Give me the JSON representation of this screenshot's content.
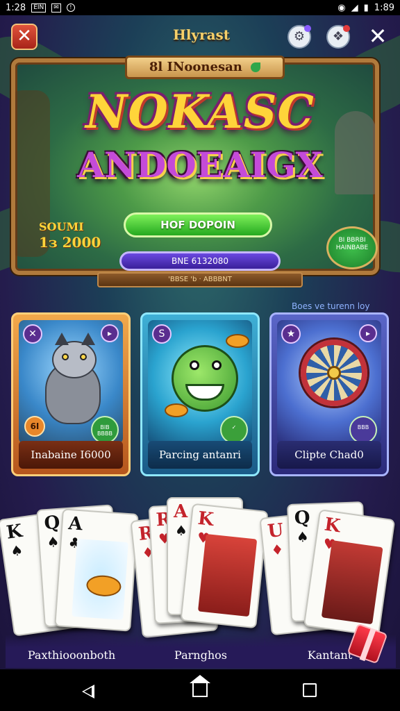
{
  "status_bar": {
    "time_left": "1:28",
    "box_icon_text": "ЕΙΝ",
    "time_right": "1:89"
  },
  "top_bar": {
    "title": "Hlyrast"
  },
  "banner": {
    "tag": "8l INoonesan",
    "title_line1": "NOKASC",
    "title_line2": "ANDOEAIGX",
    "side_label": "SOUMI",
    "side_value": "1з 2000",
    "green_button": "HOF DOPOIN",
    "purple_bar": "BNE 6132080",
    "badge_text": "BI BBRBI HAINBABE",
    "footer": "'BBSE 'b  ·  ABBBNT"
  },
  "promo_line": "Boes ve turenn loy",
  "game_cards": [
    {
      "label": "Inabaine I6000",
      "corner_l": "✕",
      "corner_r": "▸",
      "badge_l": "6I",
      "badge_r": "BIB BBBB"
    },
    {
      "label": "Parcing antanri",
      "corner_l": "S",
      "corner_r": "▸",
      "badge_r": ""
    },
    {
      "label": "Clipte Chad0",
      "corner_l": "★",
      "corner_r": "▸",
      "badge_r": "BBB"
    }
  ],
  "card_groups": [
    {
      "label": "Paxthiooonboth",
      "cards": [
        {
          "rank": "K",
          "suit": "♠"
        },
        {
          "rank": "Q",
          "suit": "♠"
        },
        {
          "rank": "A",
          "suit": "♣"
        }
      ]
    },
    {
      "label": "Parnghos",
      "cards": [
        {
          "rank": "R",
          "suit": "♦"
        },
        {
          "rank": "R",
          "suit": "♥"
        },
        {
          "rank": "A",
          "suit": "♠"
        },
        {
          "rank": "K",
          "suit": "♥"
        }
      ]
    },
    {
      "label": "Kantant",
      "cards": [
        {
          "rank": "U",
          "suit": "♦"
        },
        {
          "rank": "Q",
          "suit": "♠"
        },
        {
          "rank": "K",
          "suit": "♥"
        }
      ]
    }
  ],
  "icons": {
    "close_red": "close-icon",
    "settings": "gear-icon",
    "gift_box": "gift-icon",
    "close_white": "close-icon"
  },
  "colors": {
    "accent_gold": "#ffd43a",
    "accent_purple": "#c44bd8",
    "button_green": "#25a91f"
  }
}
